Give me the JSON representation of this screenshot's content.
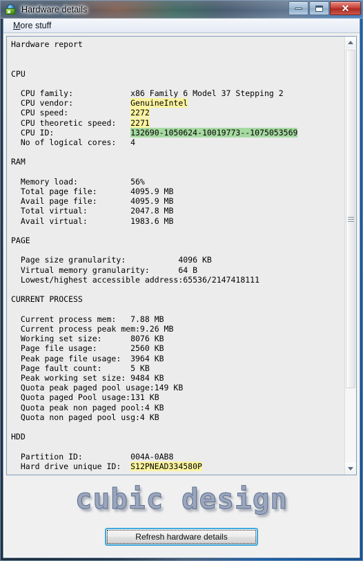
{
  "window": {
    "title": "Hardware details",
    "icon": "hardware-globe-icon",
    "controls": {
      "minimize": "–",
      "maximize": "□",
      "close": "✕"
    }
  },
  "menubar": {
    "items": [
      {
        "accel": "M",
        "rest": "ore stuff"
      }
    ]
  },
  "report": {
    "heading": "Hardware report",
    "sections": [
      {
        "title": "CPU",
        "rows": [
          {
            "label": "CPU family:",
            "value": "x86 Family 6 Model 37 Stepping 2",
            "highlight": "none"
          },
          {
            "label": "CPU vendor:",
            "value": "GenuineIntel",
            "highlight": "yellow"
          },
          {
            "label": "CPU speed:",
            "value": "2272",
            "highlight": "yellow"
          },
          {
            "label": "CPU theoretic speed:",
            "value": "2271",
            "highlight": "yellow"
          },
          {
            "label": "CPU ID:",
            "value": "132690-1050624-10019773--1075053569",
            "highlight": "green"
          },
          {
            "label": "No of logical cores:",
            "value": "4",
            "highlight": "none"
          }
        ]
      },
      {
        "title": "RAM",
        "rows": [
          {
            "label": "Memory load:",
            "value": "56%",
            "highlight": "none"
          },
          {
            "label": "Total page file:",
            "value": "4095.9 MB",
            "highlight": "none"
          },
          {
            "label": "Avail page file:",
            "value": "4095.9 MB",
            "highlight": "none"
          },
          {
            "label": "Total virtual:",
            "value": "2047.8 MB",
            "highlight": "none"
          },
          {
            "label": "Avail virtual:",
            "value": "1983.6 MB",
            "highlight": "none"
          }
        ]
      },
      {
        "title": "PAGE",
        "wide": true,
        "rows": [
          {
            "label": "Page size granularity:",
            "value": "4096 KB",
            "highlight": "none"
          },
          {
            "label": "Virtual memory granularity:",
            "value": "64 B",
            "highlight": "none"
          },
          {
            "label": "Lowest/highest accessible address:",
            "value": "65536/2147418111",
            "highlight": "none"
          }
        ]
      },
      {
        "title": "CURRENT PROCESS",
        "rows": [
          {
            "label": "Current process mem:",
            "value": "7.88 MB",
            "highlight": "none"
          },
          {
            "label": "Current process peak mem:",
            "value": "9.26 MB",
            "highlight": "none"
          },
          {
            "label": "Working set size:",
            "value": "8076 KB",
            "highlight": "none"
          },
          {
            "label": "Page file usage:",
            "value": "2560 KB",
            "highlight": "none"
          },
          {
            "label": "Peak page file usage:",
            "value": "3964 KB",
            "highlight": "none"
          },
          {
            "label": "Page fault count:",
            "value": "5 KB",
            "highlight": "none"
          },
          {
            "label": "Peak working set size:",
            "value": "9484 KB",
            "highlight": "none"
          },
          {
            "label": "Quota peak paged pool usage:",
            "value": "149 KB",
            "highlight": "none"
          },
          {
            "label": "Quota paged Pool usage:",
            "value": "131 KB",
            "highlight": "none"
          },
          {
            "label": "Quota peak non paged pool:",
            "value": "4 KB",
            "highlight": "none"
          },
          {
            "label": "Quota non paged pool usg:",
            "value": "4 KB",
            "highlight": "none"
          }
        ]
      },
      {
        "title": "HDD",
        "rows": [
          {
            "label": "Partition ID:",
            "value": "004A-0AB8",
            "highlight": "none"
          },
          {
            "label": "Hard drive unique ID:",
            "value": "S12PNEAD334580P",
            "highlight": "yellow"
          }
        ]
      }
    ]
  },
  "scrollbar": {
    "up_arrow": "scroll-up",
    "down_arrow": "scroll-down"
  },
  "footer": {
    "logo_text": "cubic design",
    "refresh_label": "Refresh hardware details"
  },
  "colors": {
    "highlight_yellow": "#fbf4a0",
    "highlight_green": "#a6d9a1",
    "client_bg": "#f0f0f0",
    "report_bg": "#ececec",
    "focus_blue": "#3fa9dd",
    "close_red": "#c8453b"
  }
}
